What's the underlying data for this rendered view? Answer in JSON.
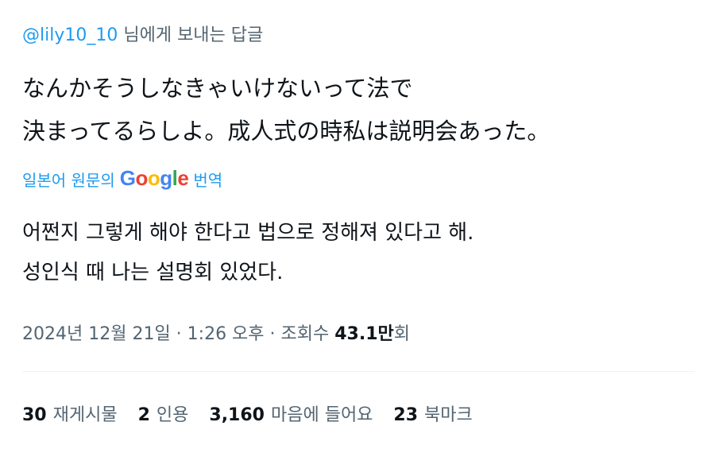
{
  "reply": {
    "mention": "@lily10_10",
    "suffix": " 님에게 보내는 답글"
  },
  "tweet": {
    "lines": [
      "なんかそうしなきゃいけないって法で",
      "決まってるらしよ。成人式の時私は説明会あった。"
    ]
  },
  "translation": {
    "prefix": "일본어 원문의",
    "google": [
      "G",
      "o",
      "o",
      "g",
      "l",
      "e"
    ],
    "suffix": "번역",
    "lines": [
      "어쩐지 그렇게 해야 한다고 법으로 정해져 있다고 해.",
      "성인식 때 나는 설명회 있었다."
    ]
  },
  "meta": {
    "timestamp": "2024년 12월 21일 · 1:26 오후 · 조회수 ",
    "views_number": "43.1",
    "views_unit": "만",
    "views_suffix": "회"
  },
  "stats": [
    {
      "num": "30",
      "label": "재게시물"
    },
    {
      "num": "2",
      "label": "인용"
    },
    {
      "num": "3,160",
      "label": "마음에 들어요"
    },
    {
      "num": "23",
      "label": "북마크"
    }
  ],
  "colors": {
    "accent": "#1d9bf0",
    "secondary_text": "#536471",
    "primary_text": "#0f1419",
    "divider": "#eff3f4"
  }
}
